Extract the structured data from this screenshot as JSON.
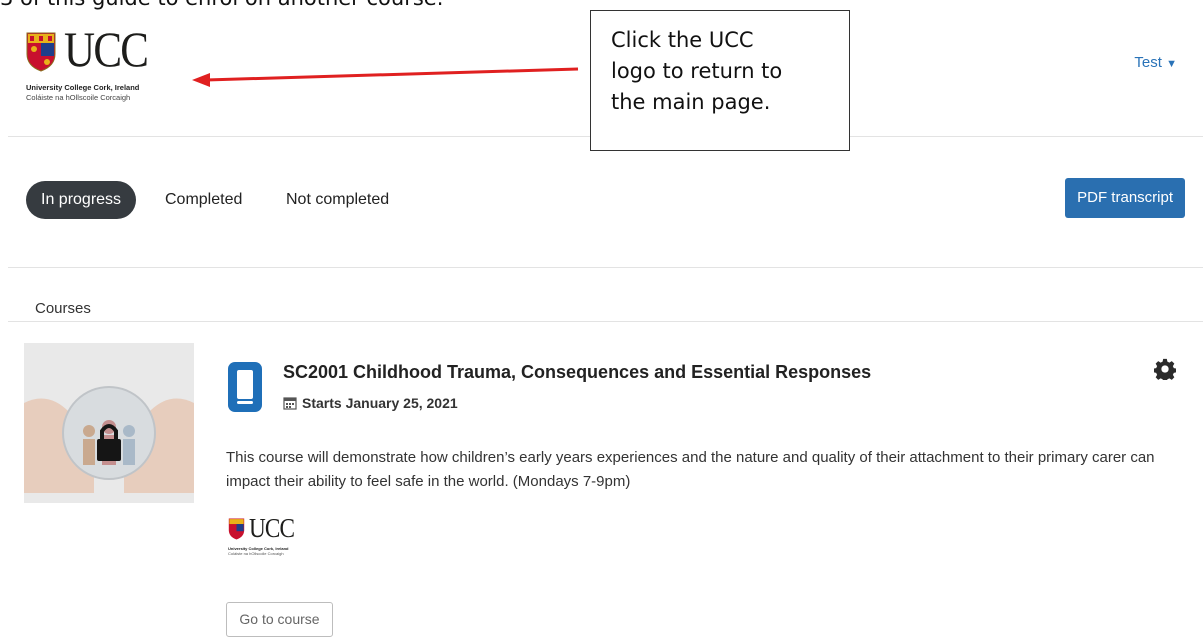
{
  "clipped_heading": "3 of this guide to enrol on another course.",
  "header": {
    "logo": {
      "wordmark": "UCC",
      "line1": "University College Cork, Ireland",
      "line2": "Coláiste na hOllscoile Corcaigh"
    },
    "user_menu": {
      "label": "Test",
      "caret": "▼"
    }
  },
  "callout": {
    "lines": [
      "Click  the UCC",
      "logo to return to",
      "the main page."
    ]
  },
  "tabs": [
    {
      "label": "In progress",
      "active": true
    },
    {
      "label": "Completed",
      "active": false
    },
    {
      "label": "Not completed",
      "active": false
    }
  ],
  "pdf_button": "PDF transcript",
  "section_title": "Courses",
  "course": {
    "title": "SC2001 Childhood Trauma, Consequences and Essential Responses",
    "date": "Starts January 25, 2021",
    "description": "This course will demonstrate how children’s early years experiences and the nature and quality of their attachment to their primary carer can impact their ability to feel safe in the world. (Mondays 7-9pm)",
    "go_button": "Go to course",
    "icons": {
      "course": "mobile-course-icon",
      "calendar": "calendar-icon",
      "settings": "gear-icon"
    }
  },
  "colors": {
    "accent": "#2a6fb0",
    "active_tab": "#363b40",
    "arrow": "#e02020",
    "link": "#2a73b8"
  }
}
